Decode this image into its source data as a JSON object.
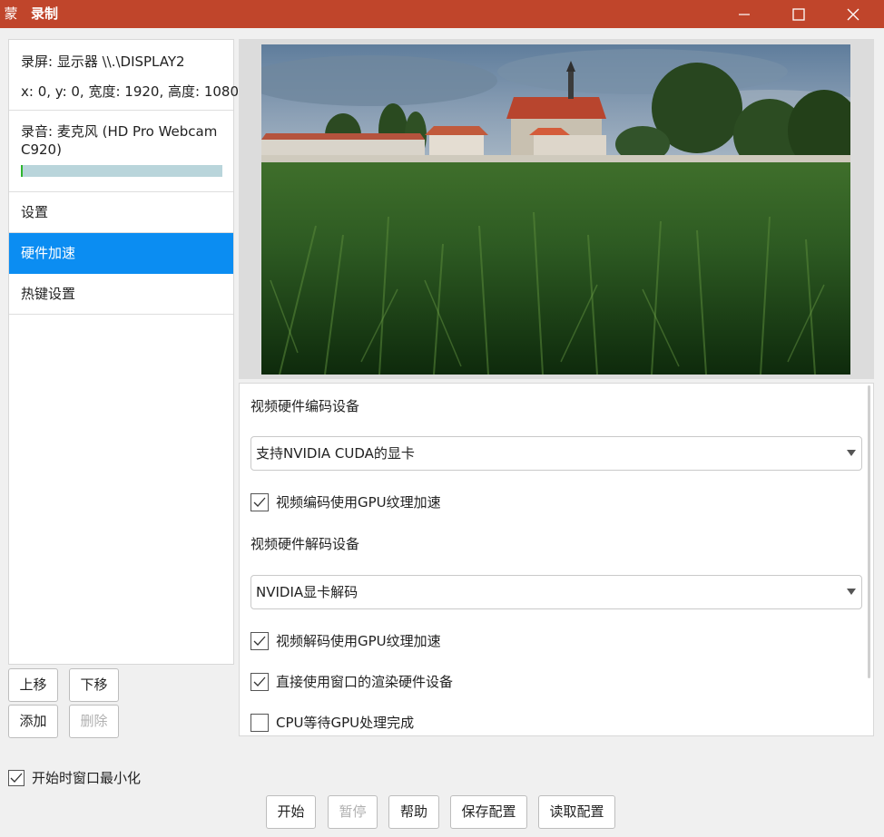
{
  "window": {
    "app_icon_glyph": "蒙",
    "title": "录制",
    "titlebar_color": "#c0452b"
  },
  "sidebar": {
    "screen_source": {
      "line1": "录屏: 显示器 \\\\.\\DISPLAY2",
      "line2": "x: 0, y: 0, 宽度: 1920, 高度: 1080"
    },
    "audio_source": {
      "line1": "录音: 麦克风 (HD Pro Webcam",
      "line2": "C920)",
      "level_fraction": 0.01
    },
    "nav_items": [
      {
        "label": "设置",
        "active": false
      },
      {
        "label": "硬件加速",
        "active": true
      },
      {
        "label": "热键设置",
        "active": false
      }
    ],
    "buttons": {
      "move_up": "上移",
      "move_down": "下移",
      "add": "添加",
      "delete": "删除"
    }
  },
  "settings": {
    "encoder_label": "视频硬件编码设备",
    "encoder_value": "支持NVIDIA CUDA的显卡",
    "encoder_gpu_texture": {
      "label": "视频编码使用GPU纹理加速",
      "checked": true
    },
    "decoder_label": "视频硬件解码设备",
    "decoder_value": "NVIDIA显卡解码",
    "decoder_gpu_texture": {
      "label": "视频解码使用GPU纹理加速",
      "checked": true
    },
    "use_window_render_device": {
      "label": "直接使用窗口的渲染硬件设备",
      "checked": true
    },
    "cpu_wait_gpu": {
      "label": "CPU等待GPU处理完成",
      "checked": false
    }
  },
  "footer": {
    "minimize_on_start": {
      "label": "开始时窗口最小化",
      "checked": true
    },
    "buttons": {
      "start": "开始",
      "pause": "暂停",
      "help": "帮助",
      "save_config": "保存配置",
      "load_config": "读取配置"
    }
  },
  "colors": {
    "accent": "#0b8df2",
    "level_meter": "#2fb52f"
  }
}
